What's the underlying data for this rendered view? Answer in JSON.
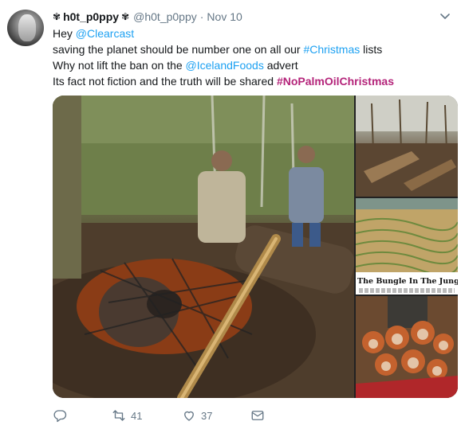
{
  "tweet": {
    "author": {
      "flower_left": "✾",
      "display_name": "h0t_p0ppy",
      "flower_right": "✾",
      "handle": "@h0t_p0ppy",
      "separator": "·",
      "date": "Nov 10"
    },
    "lines": [
      {
        "parts": [
          {
            "t": "Hey "
          },
          {
            "t": "@Clearcast",
            "link": true
          }
        ]
      },
      {
        "parts": [
          {
            "t": "saving the planet should be number one on all our "
          },
          {
            "t": "#Christmas",
            "link": true
          },
          {
            "t": " lists"
          }
        ]
      },
      {
        "parts": [
          {
            "t": "Why not lift the ban on the "
          },
          {
            "t": "@IcelandFoods",
            "link": true
          },
          {
            "t": "  advert"
          }
        ]
      },
      {
        "parts": [
          {
            "t": "Its fact not fiction and the truth will be shared "
          },
          {
            "t": "#NoPalmOilChristmas",
            "link": true,
            "bold": true
          }
        ]
      }
    ],
    "media": {
      "side_caption": "The Bungle In The Jungle"
    },
    "actions": {
      "reply_count": "",
      "retweet_count": "41",
      "like_count": "37"
    },
    "colors": {
      "link": "#1da1f2",
      "hashtag_highlight": "#b4247a",
      "muted": "#657786"
    },
    "icons": [
      "caret-down-icon",
      "reply-icon",
      "retweet-icon",
      "heart-icon",
      "direct-message-icon"
    ]
  }
}
